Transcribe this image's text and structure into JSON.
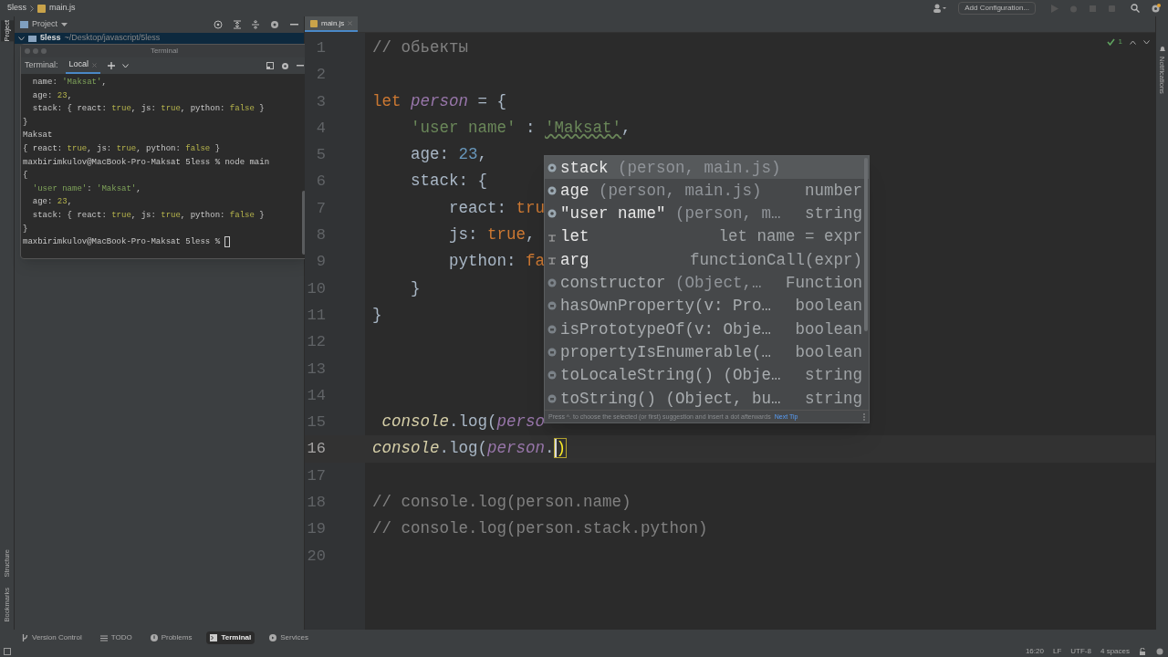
{
  "breadcrumbs": [
    "5less",
    "main.js"
  ],
  "toolbar": {
    "config_button": "Add Configuration..."
  },
  "left_stripe": [
    "Project",
    "Structure",
    "Bookmarks"
  ],
  "right_stripe": [
    "Notifications"
  ],
  "project_panel": {
    "title": "Project",
    "tree": [
      {
        "label": "5less",
        "path": "~/Desktop/javascript/5less",
        "expanded": true,
        "selected": true
      }
    ]
  },
  "terminal_window": {
    "title": "Terminal",
    "label": "Terminal:",
    "tabs": [
      {
        "label": "Local",
        "selected": true
      }
    ],
    "lines": [
      [
        {
          "kind": "plain",
          "text": "  name: "
        },
        {
          "kind": "string",
          "text": "'Maksat'"
        },
        {
          "kind": "plain",
          "text": ","
        }
      ],
      [
        {
          "kind": "plain",
          "text": "  age: "
        },
        {
          "kind": "literal",
          "text": "23"
        },
        {
          "kind": "plain",
          "text": ","
        }
      ],
      [
        {
          "kind": "plain",
          "text": "  stack: { react: "
        },
        {
          "kind": "literal",
          "text": "true"
        },
        {
          "kind": "plain",
          "text": ", js: "
        },
        {
          "kind": "literal",
          "text": "true"
        },
        {
          "kind": "plain",
          "text": ", python: "
        },
        {
          "kind": "literal",
          "text": "false"
        },
        {
          "kind": "plain",
          "text": " }"
        }
      ],
      [
        {
          "kind": "plain",
          "text": "}"
        }
      ],
      [
        {
          "kind": "plain",
          "text": "Maksat"
        }
      ],
      [
        {
          "kind": "plain",
          "text": "{ react: "
        },
        {
          "kind": "literal",
          "text": "true"
        },
        {
          "kind": "plain",
          "text": ", js: "
        },
        {
          "kind": "literal",
          "text": "true"
        },
        {
          "kind": "plain",
          "text": ", python: "
        },
        {
          "kind": "literal",
          "text": "false"
        },
        {
          "kind": "plain",
          "text": " }"
        }
      ],
      [
        {
          "kind": "plain",
          "text": "maxbirimkulov@MacBook-Pro-Maksat 5less % node main"
        }
      ],
      [
        {
          "kind": "plain",
          "text": "{"
        }
      ],
      [
        {
          "kind": "string",
          "text": "  'user name'"
        },
        {
          "kind": "plain",
          "text": ": "
        },
        {
          "kind": "string",
          "text": "'Maksat'"
        },
        {
          "kind": "plain",
          "text": ","
        }
      ],
      [
        {
          "kind": "plain",
          "text": "  age: "
        },
        {
          "kind": "literal",
          "text": "23"
        },
        {
          "kind": "plain",
          "text": ","
        }
      ],
      [
        {
          "kind": "plain",
          "text": "  stack: { react: "
        },
        {
          "kind": "literal",
          "text": "true"
        },
        {
          "kind": "plain",
          "text": ", js: "
        },
        {
          "kind": "literal",
          "text": "true"
        },
        {
          "kind": "plain",
          "text": ", python: "
        },
        {
          "kind": "literal",
          "text": "false"
        },
        {
          "kind": "plain",
          "text": " }"
        }
      ],
      [
        {
          "kind": "plain",
          "text": "}"
        }
      ],
      [
        {
          "kind": "plain",
          "text": "maxbirimkulov@MacBook-Pro-Maksat 5less % "
        },
        {
          "kind": "cursor"
        }
      ]
    ]
  },
  "editor": {
    "tabs": [
      {
        "label": "main.js",
        "selected": true
      }
    ],
    "inspection_count": "1",
    "lines": [
      {
        "number": "1",
        "current": false,
        "tokens": [
          {
            "kind": "comment",
            "text": "// обьекты"
          }
        ]
      },
      {
        "number": "2",
        "current": false
      },
      {
        "number": "3",
        "current": false,
        "tokens": [
          {
            "kind": "keyword",
            "text": "let "
          },
          {
            "kind": "variable",
            "text": "person"
          },
          {
            "kind": "plain",
            "text": " = {"
          }
        ]
      },
      {
        "number": "4",
        "current": false,
        "tokens": [
          {
            "kind": "string",
            "text": "    'user name'"
          },
          {
            "kind": "plain",
            "text": " : "
          },
          {
            "kind": "string_typo",
            "text": "'Maksat'"
          },
          {
            "kind": "plain",
            "text": ","
          }
        ]
      },
      {
        "number": "5",
        "current": false,
        "tokens": [
          {
            "kind": "plain",
            "text": "    age: "
          },
          {
            "kind": "number",
            "text": "23"
          },
          {
            "kind": "plain",
            "text": ","
          }
        ]
      },
      {
        "number": "6",
        "current": false,
        "tokens": [
          {
            "kind": "plain",
            "text": "    stack: {"
          }
        ]
      },
      {
        "number": "7",
        "current": false,
        "tokens": [
          {
            "kind": "plain",
            "text": "        react: "
          },
          {
            "kind": "keyword",
            "text": "tru"
          }
        ]
      },
      {
        "number": "8",
        "current": false,
        "tokens": [
          {
            "kind": "plain",
            "text": "        js: "
          },
          {
            "kind": "keyword",
            "text": "true"
          },
          {
            "kind": "plain",
            "text": ","
          }
        ]
      },
      {
        "number": "9",
        "current": false,
        "tokens": [
          {
            "kind": "plain",
            "text": "        python: "
          },
          {
            "kind": "keyword",
            "text": "fa"
          }
        ]
      },
      {
        "number": "10",
        "current": false,
        "tokens": [
          {
            "kind": "plain",
            "text": "    }"
          }
        ]
      },
      {
        "number": "11",
        "current": false,
        "tokens": [
          {
            "kind": "plain",
            "text": "}"
          }
        ]
      },
      {
        "number": "12",
        "current": false
      },
      {
        "number": "13",
        "current": false
      },
      {
        "number": "14",
        "current": false
      },
      {
        "number": "15",
        "current": false,
        "tokens": [
          {
            "kind": "global",
            "text": " console"
          },
          {
            "kind": "plain",
            "text": ".log("
          },
          {
            "kind": "variable",
            "text": "perso"
          }
        ]
      },
      {
        "number": "16",
        "current": true,
        "tokens": [
          {
            "kind": "global",
            "text": "console"
          },
          {
            "kind": "plain",
            "text": ".log("
          },
          {
            "kind": "variable",
            "text": "person"
          },
          {
            "kind": "plain",
            "text": "."
          },
          {
            "kind": "matched_bracket",
            "text": ")"
          }
        ]
      },
      {
        "number": "17",
        "current": false
      },
      {
        "number": "18",
        "current": false,
        "tokens": [
          {
            "kind": "comment",
            "text": "// console.log(person.name)"
          }
        ]
      },
      {
        "number": "19",
        "current": false,
        "tokens": [
          {
            "kind": "comment",
            "text": "// console.log(person.stack.python)"
          }
        ]
      },
      {
        "number": "20",
        "current": false
      }
    ],
    "completion": {
      "items": [
        {
          "kind": "property",
          "name": "stack",
          "detail": " (person, main.js)",
          "selected": true
        },
        {
          "kind": "property",
          "name": "age",
          "detail": " (person, main.js)",
          "type": "number",
          "selected": false
        },
        {
          "kind": "property",
          "name": "\"user name\"",
          "detail": " (person, m…",
          "type": "string",
          "selected": false
        },
        {
          "kind": "template",
          "name": "let",
          "type": "let name = expr",
          "selected": false
        },
        {
          "kind": "template",
          "name": "arg",
          "type": "functionCall(expr)",
          "selected": false
        },
        {
          "kind": "inherited_property",
          "name": "constructor",
          "detail": " (Object,…",
          "type": "Function",
          "selected": false
        },
        {
          "kind": "inherited_method",
          "name": "hasOwnProperty(v: Pro…",
          "type": "boolean",
          "selected": false
        },
        {
          "kind": "inherited_method",
          "name": "isPrototypeOf(v: Obje…",
          "type": "boolean",
          "selected": false
        },
        {
          "kind": "inherited_method",
          "name": "propertyIsEnumerable(…",
          "type": "boolean",
          "selected": false
        },
        {
          "kind": "inherited_method",
          "name": "toLocaleString() (Obje…",
          "type": "string",
          "selected": false
        },
        {
          "kind": "inherited_method",
          "name": "toString() (Object, bu…",
          "type": "string",
          "selected": false
        }
      ],
      "hint": "Press ^. to choose the selected (or first) suggestion and insert a dot afterwards",
      "hint_link": "Next Tip"
    }
  },
  "tool_windows": [
    {
      "label": "Version Control",
      "kind": "vcs",
      "selected": false
    },
    {
      "label": "TODO",
      "kind": "list",
      "selected": false
    },
    {
      "label": "Problems",
      "kind": "problems",
      "selected": false
    },
    {
      "label": "Terminal",
      "kind": "terminal",
      "selected": true
    },
    {
      "label": "Services",
      "kind": "services",
      "selected": false
    }
  ],
  "status_bar": [
    "16:20",
    "LF",
    "UTF-8",
    "4 spaces"
  ]
}
